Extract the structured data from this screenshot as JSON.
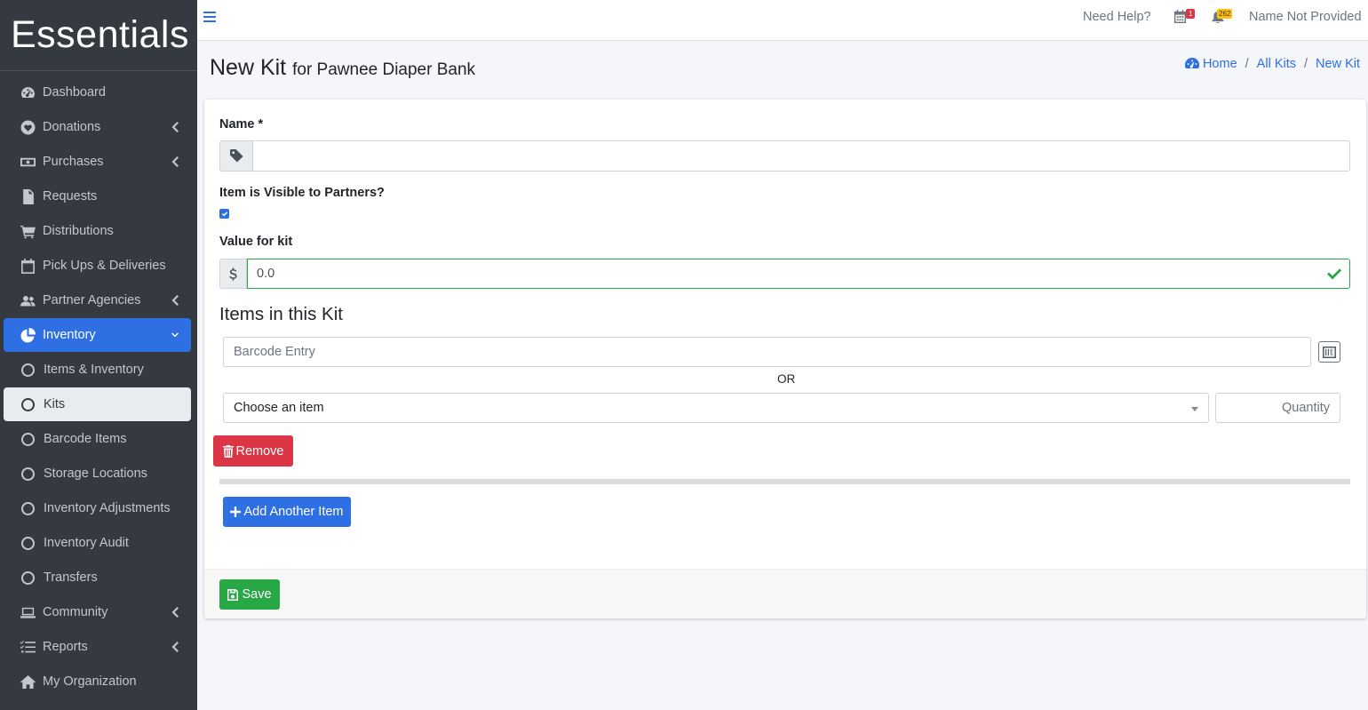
{
  "brand": "Essentials",
  "sidebar": {
    "items": [
      {
        "label": "Dashboard",
        "icon": "dashboard-icon"
      },
      {
        "label": "Donations",
        "icon": "heart-icon"
      },
      {
        "label": "Purchases",
        "icon": "money-icon"
      },
      {
        "label": "Requests",
        "icon": "file-icon"
      },
      {
        "label": "Distributions",
        "icon": "cart-icon"
      },
      {
        "label": "Pick Ups & Deliveries",
        "icon": "calendar-icon"
      },
      {
        "label": "Partner Agencies",
        "icon": "users-icon"
      },
      {
        "label": "Inventory",
        "icon": "pie-chart-icon"
      },
      {
        "label": "Items & Inventory",
        "icon": "circle-icon"
      },
      {
        "label": "Kits",
        "icon": "circle-icon"
      },
      {
        "label": "Barcode Items",
        "icon": "circle-icon"
      },
      {
        "label": "Storage Locations",
        "icon": "circle-icon"
      },
      {
        "label": "Inventory Adjustments",
        "icon": "circle-icon"
      },
      {
        "label": "Inventory Audit",
        "icon": "circle-icon"
      },
      {
        "label": "Transfers",
        "icon": "circle-icon"
      },
      {
        "label": "Community",
        "icon": "laptop-icon"
      },
      {
        "label": "Reports",
        "icon": "list-icon"
      },
      {
        "label": "My Organization",
        "icon": "home-icon"
      }
    ]
  },
  "topbar": {
    "need_help": "Need Help?",
    "calendar_badge": "1",
    "bell_badge": "262",
    "user_name": "Name Not Provided"
  },
  "header": {
    "title": "New Kit",
    "subtitle": "for Pawnee Diaper Bank",
    "breadcrumb": [
      "Home",
      "All Kits",
      "New Kit"
    ]
  },
  "form": {
    "name_label": "Name *",
    "name_value": "",
    "visible_label": "Item is Visible to Partners?",
    "visible_checked": true,
    "value_label": "Value for kit",
    "value": "0.0",
    "items_title": "Items in this Kit",
    "barcode_placeholder": "Barcode Entry",
    "or_text": "OR",
    "select_value": "Choose an item",
    "quantity_placeholder": "Quantity",
    "remove_label": "Remove",
    "add_label": "Add Another Item",
    "save_label": "Save"
  },
  "colors": {
    "primary": "#2f6fe4",
    "danger": "#dc3545",
    "success": "#28a745",
    "sidebar_bg": "#343a40"
  }
}
